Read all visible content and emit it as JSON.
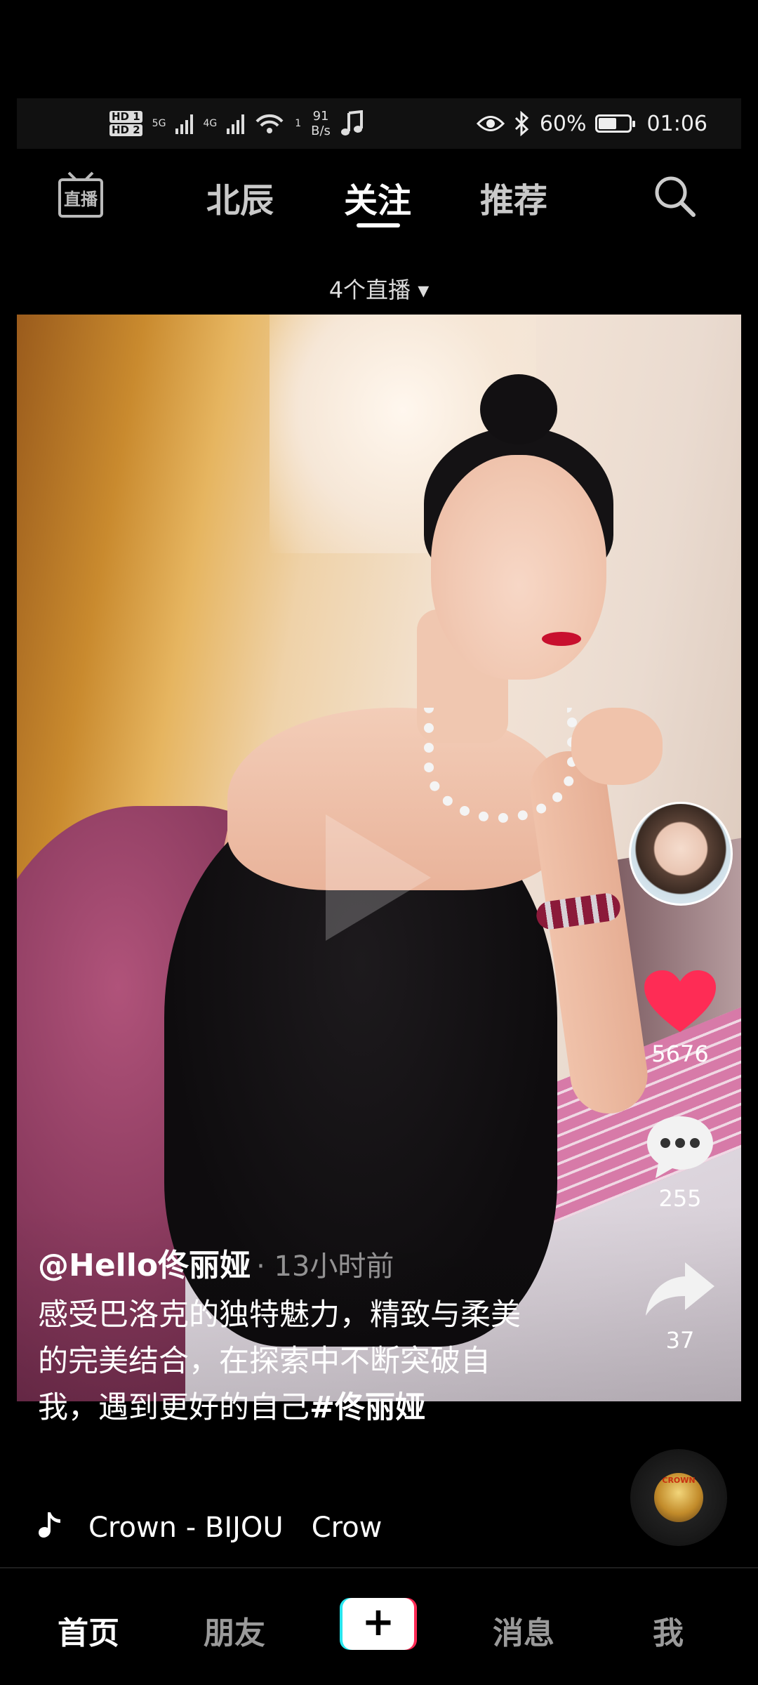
{
  "status_bar": {
    "hd1": "HD 1",
    "hd2": "HD 2",
    "net1": "5G",
    "net2": "4G",
    "wifi_sub": "1",
    "speed_value": "91",
    "speed_unit": "B/s",
    "battery_percent": "60%",
    "battery_level": 0.6,
    "time": "01:06"
  },
  "top_nav": {
    "live_icon_label": "直播",
    "tabs": [
      {
        "label": "北辰",
        "active": false
      },
      {
        "label": "关注",
        "active": true
      },
      {
        "label": "推荐",
        "active": false
      }
    ]
  },
  "live_count": "4个直播 ▾",
  "video": {
    "author": "@Hello佟丽娅",
    "time_ago": "· 13小时前",
    "description": "感受巴洛克的独特魅力，精致与柔美的完美结合，在探索中不断突破自我，遇到更好的自己",
    "hashtag": "#佟丽娅",
    "likes": "5676",
    "comments": "255",
    "shares": "37",
    "music": "Crown - BIJOU　Crow",
    "disc_label": "CROWN"
  },
  "bottom_nav": {
    "home": "首页",
    "friends": "朋友",
    "create": "+",
    "messages": "消息",
    "me": "我"
  },
  "colors": {
    "like_red": "#fe2c55",
    "background": "#000000",
    "plus_cyan": "#27e6ee",
    "plus_red": "#ff2a55"
  }
}
